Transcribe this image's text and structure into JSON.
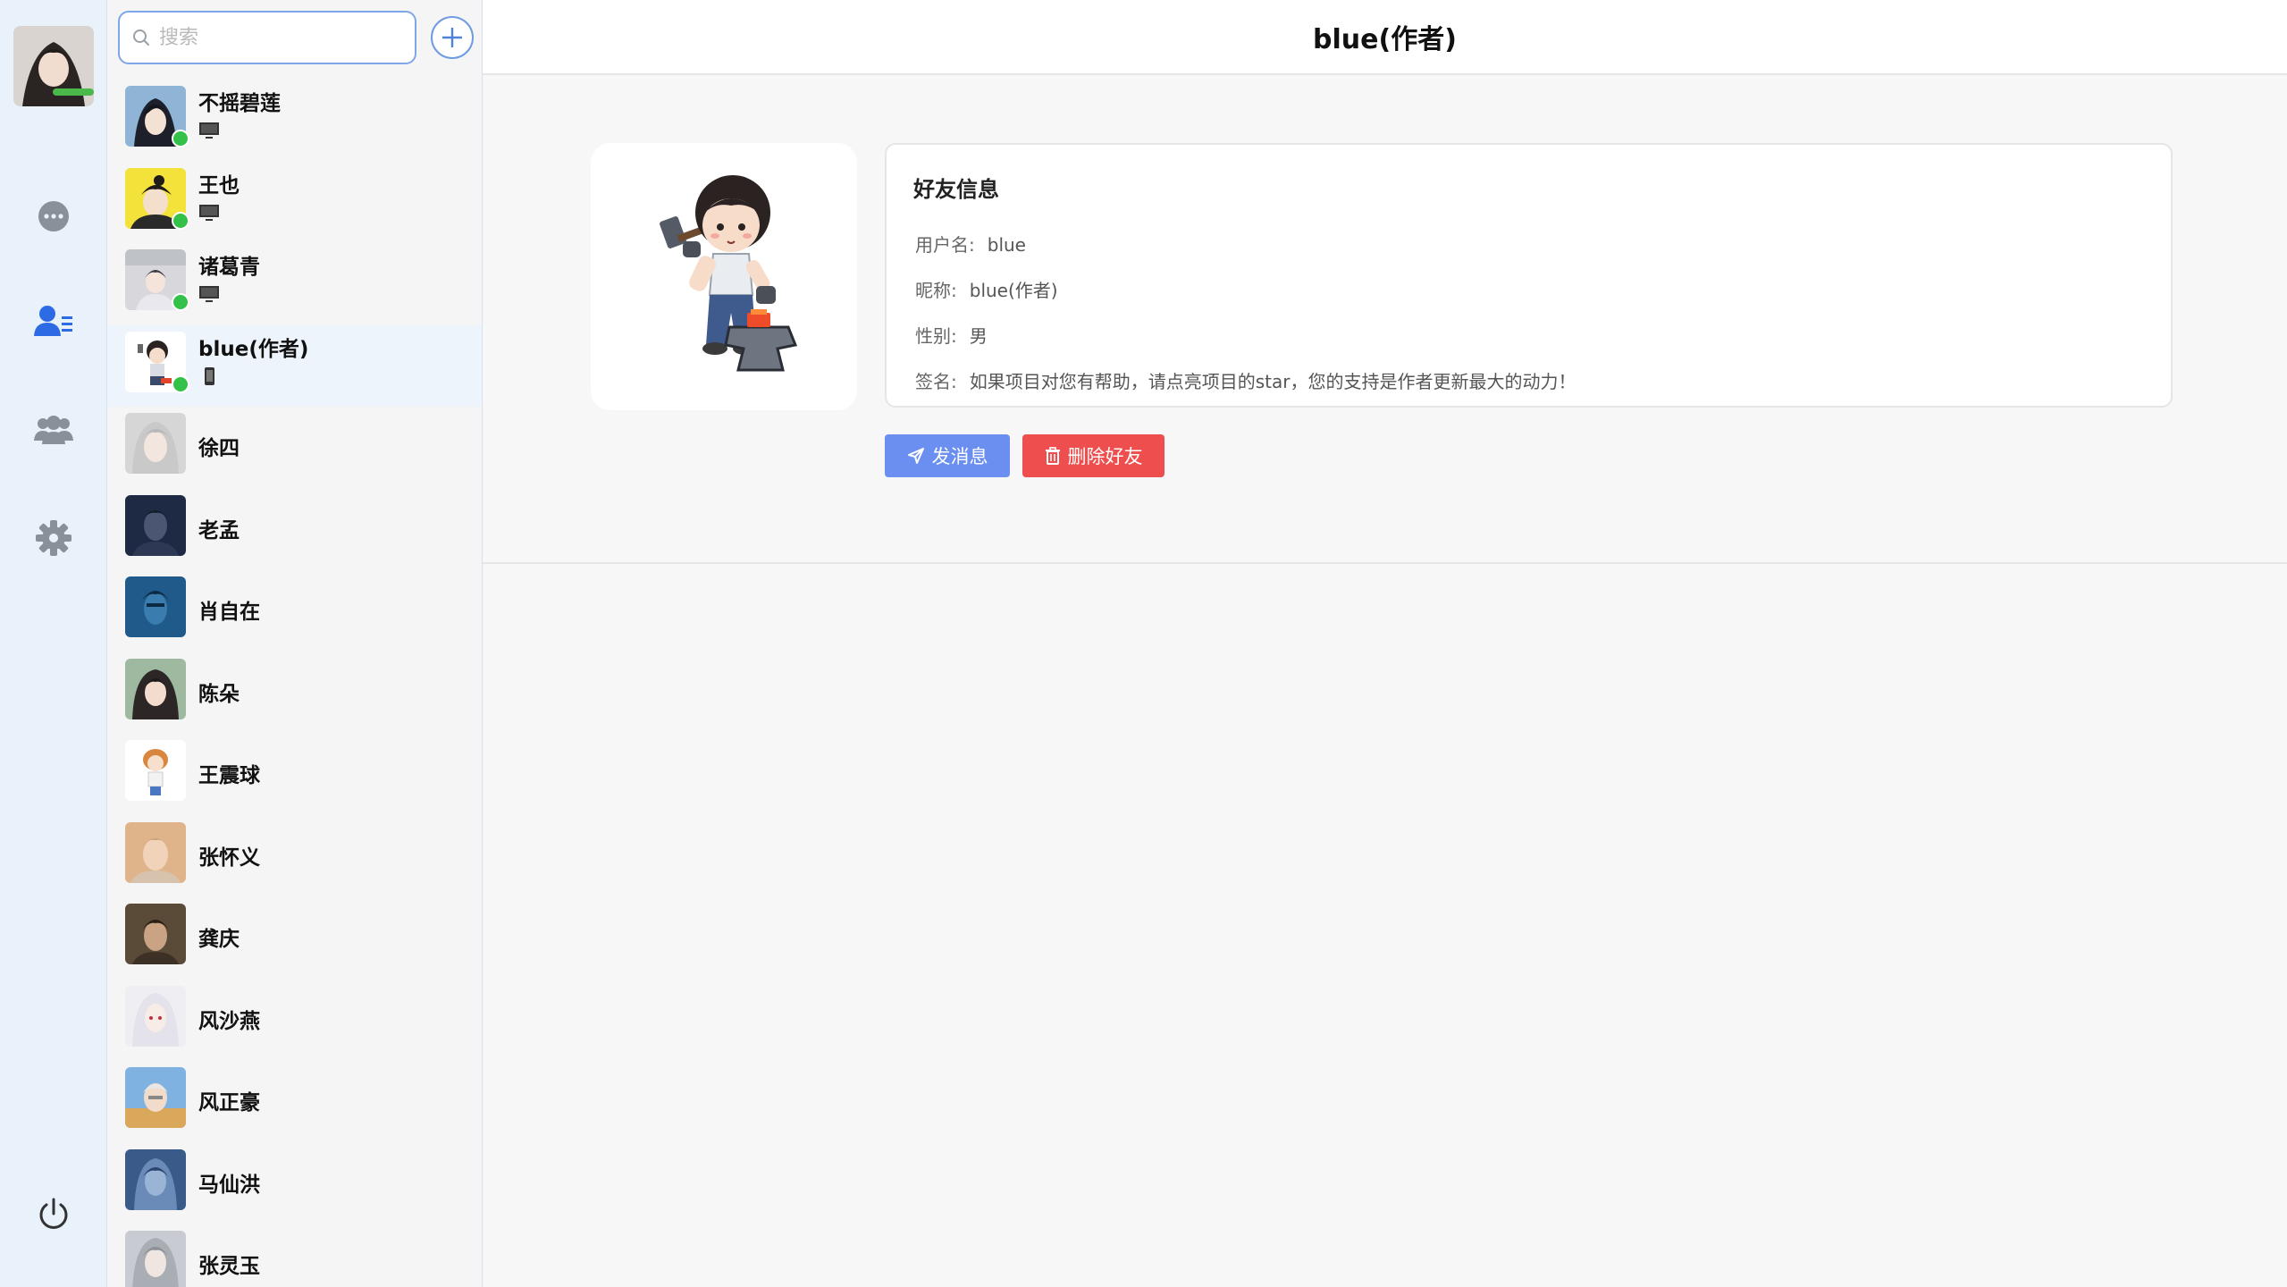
{
  "sidebar": {
    "nav_icons": [
      "chat-icon",
      "contacts-icon",
      "groups-icon",
      "settings-icon"
    ],
    "logout_icon": "power-icon",
    "active_color": "#2d6be4",
    "inactive_color": "#8a9099"
  },
  "search": {
    "placeholder": "搜索"
  },
  "contacts": [
    {
      "name": "不摇碧莲",
      "online": true,
      "device": "desktop"
    },
    {
      "name": "王也",
      "online": true,
      "device": "desktop"
    },
    {
      "name": "诸葛青",
      "online": true,
      "device": "desktop"
    },
    {
      "name": "blue(作者)",
      "online": true,
      "device": "mobile",
      "active": true
    },
    {
      "name": "徐四"
    },
    {
      "name": "老孟"
    },
    {
      "name": "肖自在"
    },
    {
      "name": "陈朵"
    },
    {
      "name": "王震球"
    },
    {
      "name": "张怀义"
    },
    {
      "name": "龚庆"
    },
    {
      "name": "风沙燕"
    },
    {
      "name": "风正豪"
    },
    {
      "name": "马仙洪"
    },
    {
      "name": "张灵玉"
    }
  ],
  "main": {
    "title": "blue(作者)",
    "info": {
      "heading": "好友信息",
      "username_label": "用户名:",
      "username": "blue",
      "nickname_label": "昵称:",
      "nickname": "blue(作者)",
      "gender_label": "性别:",
      "gender": "男",
      "signature_label": "签名:",
      "signature": "如果项目对您有帮助，请点亮项目的star，您的支持是作者更新最大的动力！"
    },
    "send_button": "发消息",
    "delete_button": "删除好友",
    "send_color": "#6a8ff0",
    "delete_color": "#ef4e4e"
  }
}
